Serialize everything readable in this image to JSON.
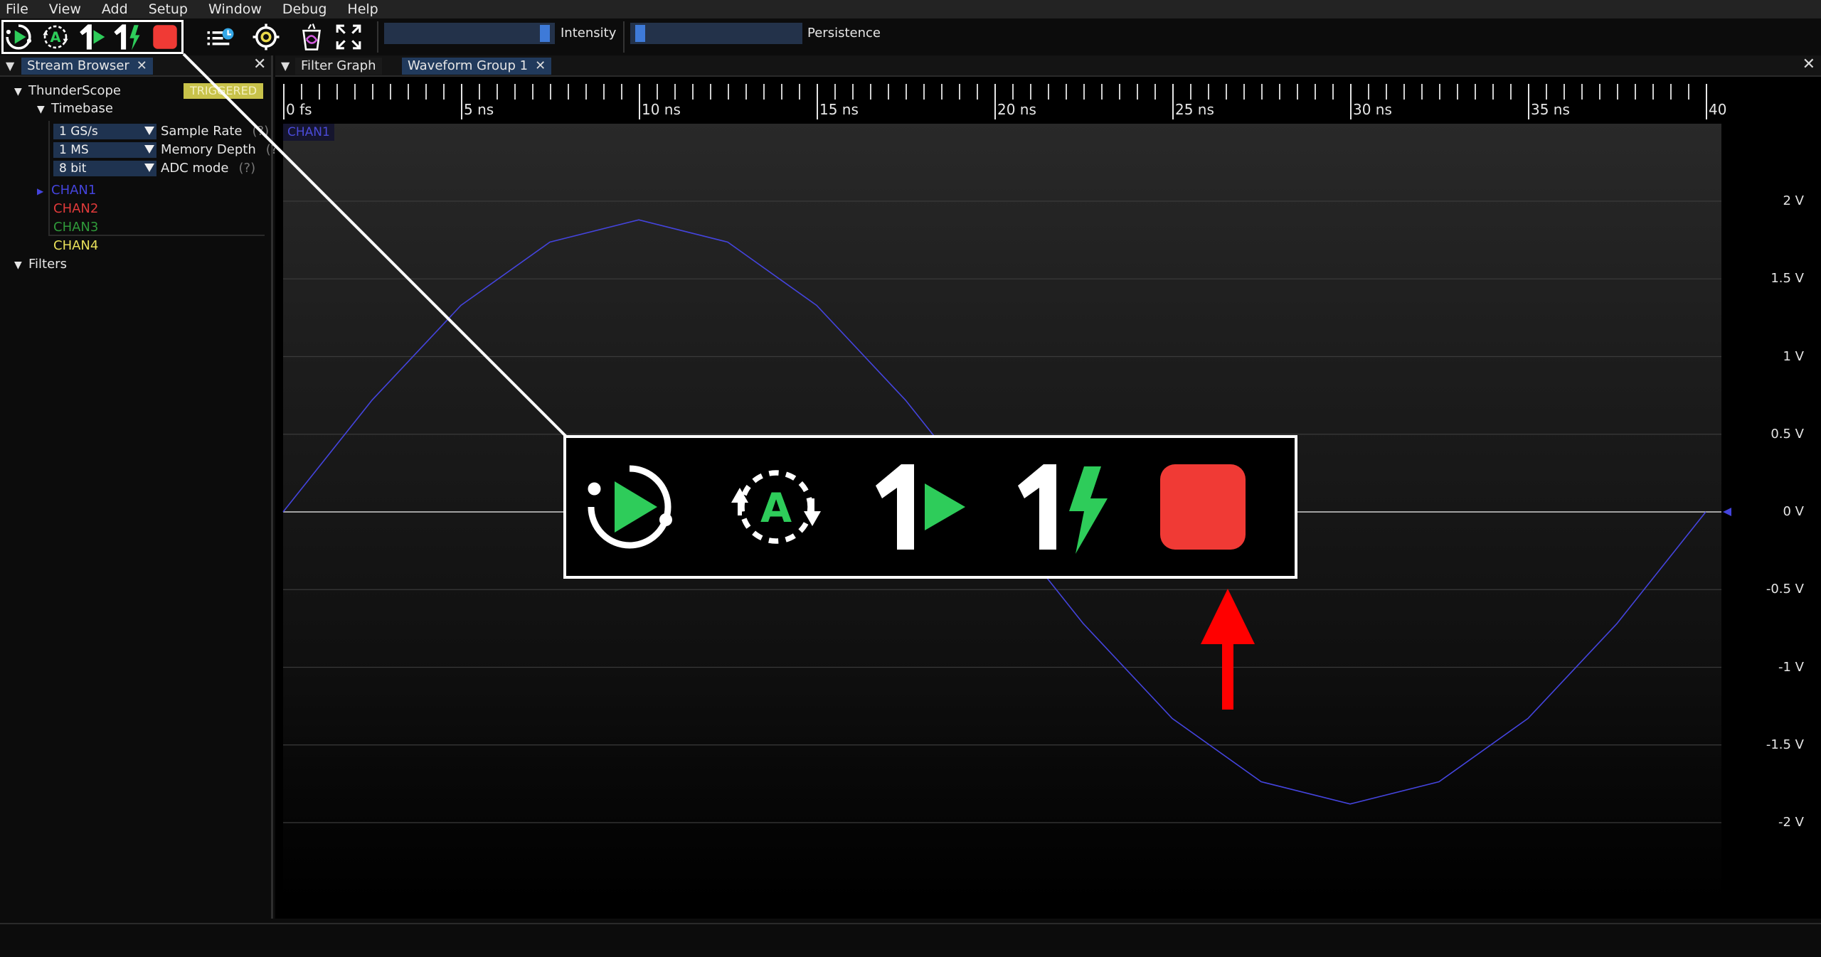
{
  "menu": [
    "File",
    "View",
    "Add",
    "Setup",
    "Window",
    "Debug",
    "Help"
  ],
  "toolbar": {
    "buttons": [
      {
        "name": "start-trigger-icon"
      },
      {
        "name": "auto-trigger-icon"
      },
      {
        "name": "single-trigger-icon"
      },
      {
        "name": "force-trigger-icon"
      },
      {
        "name": "stop-trigger-icon"
      },
      {
        "name": "history-icon"
      },
      {
        "name": "settings-icon"
      },
      {
        "name": "clear-sweeps-icon"
      },
      {
        "name": "fullscreen-icon"
      }
    ],
    "intensity_label": "Intensity",
    "intensity_value": 0.97,
    "persistence_label": "Persistence",
    "persistence_value": 0.03
  },
  "left_panel": {
    "tab_label": "Stream Browser",
    "device": "ThunderScope",
    "trigger_status": "TRIGGERED",
    "timebase_label": "Timebase",
    "params": [
      {
        "value": "1 GS/s",
        "label": "Sample Rate",
        "help": "(?)"
      },
      {
        "value": "1 MS",
        "label": "Memory Depth",
        "help": "(?)"
      },
      {
        "value": "8 bit",
        "label": "ADC mode",
        "help": "(?)"
      }
    ],
    "channels": [
      {
        "name": "CHAN1",
        "color": "#4444dd"
      },
      {
        "name": "CHAN2",
        "color": "#e03a3a"
      },
      {
        "name": "CHAN3",
        "color": "#2f9a3a"
      },
      {
        "name": "CHAN4",
        "color": "#e8e05a"
      }
    ],
    "filters_label": "Filters"
  },
  "right_tabs": {
    "filter_graph": "Filter Graph",
    "waveform_group": "Waveform Group 1"
  },
  "waveform": {
    "channel_label": "CHAN1",
    "time_labels": [
      "0 fs",
      "5 ns",
      "10 ns",
      "15 ns",
      "20 ns",
      "25 ns",
      "30 ns",
      "35 ns",
      "40"
    ],
    "volt_labels": [
      "2 V",
      "1.5 V",
      "1 V",
      "0.5 V",
      "0 V",
      "-0.5 V",
      "-1 V",
      "-1.5 V",
      "-2 V"
    ],
    "trace_color": "#4444dd",
    "samples_ns": [
      0,
      2.5,
      5,
      7.5,
      10,
      12.5,
      15,
      17.5,
      20,
      22.5,
      25,
      27.5,
      30,
      32.5,
      35,
      37.5,
      40
    ],
    "trace_amplitude_v": 1.88,
    "trace_period_ns": 40
  },
  "annotation": {
    "arrow_color": "#ff0000",
    "highlight_color": "#ffffff"
  }
}
